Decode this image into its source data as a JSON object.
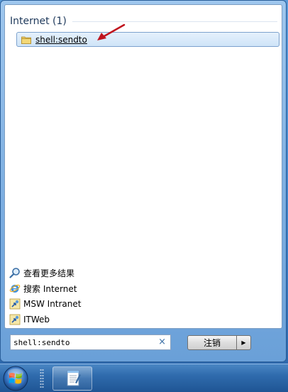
{
  "results": {
    "group_title": "Internet (1)",
    "items": [
      {
        "label": "shell:sendto",
        "icon": "folder-icon"
      }
    ]
  },
  "links": [
    {
      "label": "查看更多结果",
      "icon": "search-icon"
    },
    {
      "label": "搜索 Internet",
      "icon": "ie-icon"
    },
    {
      "label": "MSW Intranet",
      "icon": "shortcut-icon"
    },
    {
      "label": "ITWeb",
      "icon": "shortcut-icon"
    }
  ],
  "search": {
    "value": "shell:sendto",
    "clear_symbol": "×"
  },
  "shutdown": {
    "label": "注销",
    "arrow_symbol": "▶"
  },
  "taskbar": {
    "start_icon": "windows-orb-icon",
    "pinned_icon": "notepad-icon"
  },
  "colors": {
    "annotation_arrow": "#c0141e",
    "accent": "#3a6ea5"
  }
}
